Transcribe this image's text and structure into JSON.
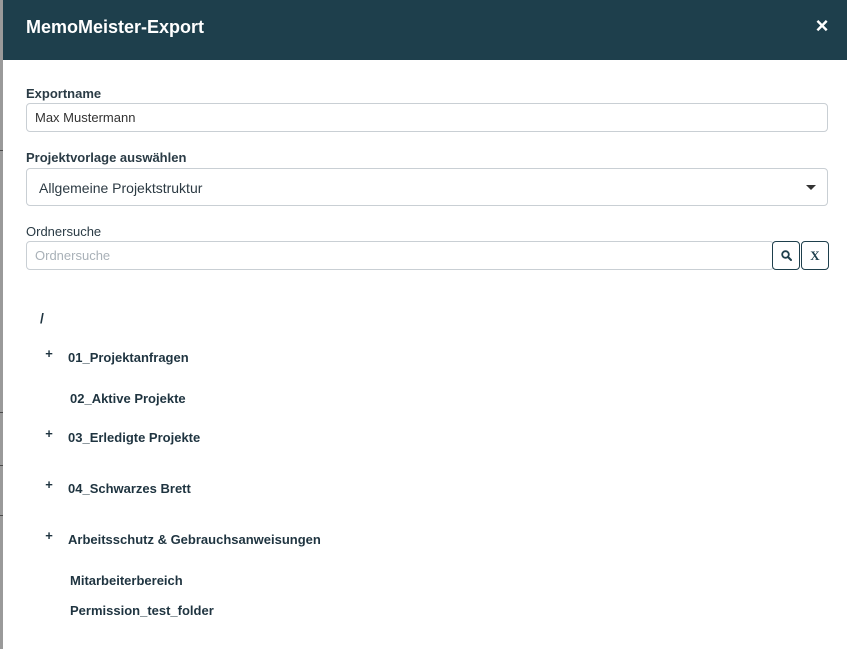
{
  "dialog": {
    "title": "MemoMeister-Export",
    "close_symbol": "×"
  },
  "form": {
    "export_name": {
      "label": "Exportname",
      "value": "Max Mustermann"
    },
    "template": {
      "label": "Projektvorlage auswählen",
      "selected": "Allgemeine Projektstruktur"
    },
    "folder_search": {
      "label": "Ordnersuche",
      "placeholder": "Ordnersuche",
      "value": "",
      "search_icon": "search-icon",
      "clear_label": "X"
    }
  },
  "tree": {
    "root": "/",
    "items": [
      {
        "label": "01_Projektanfragen",
        "expandable": true,
        "toggle": "+"
      },
      {
        "label": "02_Aktive Projekte",
        "expandable": false
      },
      {
        "label": "03_Erledigte Projekte",
        "expandable": true,
        "toggle": "+"
      },
      {
        "label": "04_Schwarzes Brett",
        "expandable": true,
        "toggle": "+"
      },
      {
        "label": "Arbeitsschutz & Gebrauchsanweisungen",
        "expandable": true,
        "toggle": "+"
      },
      {
        "label": "Mitarbeiterbereich",
        "expandable": false
      },
      {
        "label": "Permission_test_folder",
        "expandable": false
      }
    ]
  },
  "colors": {
    "header_bg": "#1e3f4c",
    "header_text": "#ffffff",
    "tree_text": "#1f3440",
    "input_border": "#c9cfd4"
  }
}
